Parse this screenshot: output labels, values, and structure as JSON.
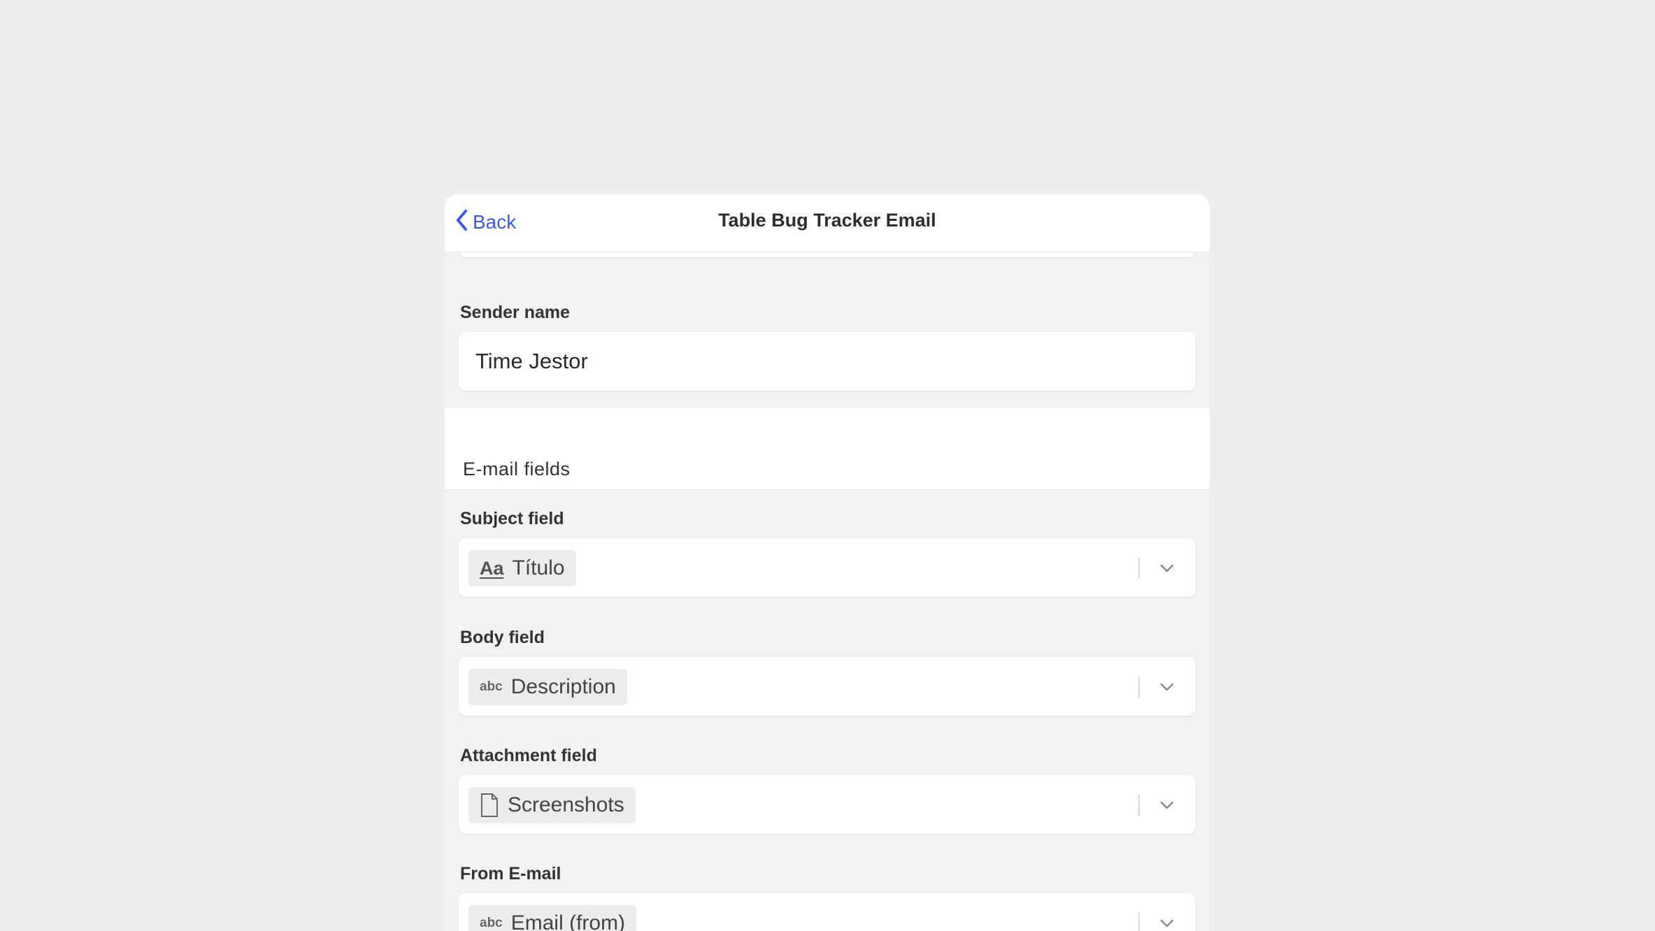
{
  "nav": {
    "back_label": "Back",
    "title": "Table Bug Tracker Email"
  },
  "sender": {
    "label": "Sender name",
    "value": "Time Jestor"
  },
  "section": {
    "title": "E-mail fields"
  },
  "fields": {
    "subject": {
      "label": "Subject field",
      "chip_icon": "Aa",
      "chip_label": "Título"
    },
    "body": {
      "label": "Body field",
      "chip_icon": "abc",
      "chip_label": "Description"
    },
    "attachment": {
      "label": "Attachment field",
      "chip_icon": "file-icon",
      "chip_label": "Screenshots"
    },
    "from": {
      "label": "From E-mail",
      "chip_icon": "abc",
      "chip_label": "Email (from)"
    }
  },
  "colors": {
    "accent": "#3b5ae6",
    "background": "#eceeeb",
    "panel": "#f2f2f0"
  }
}
